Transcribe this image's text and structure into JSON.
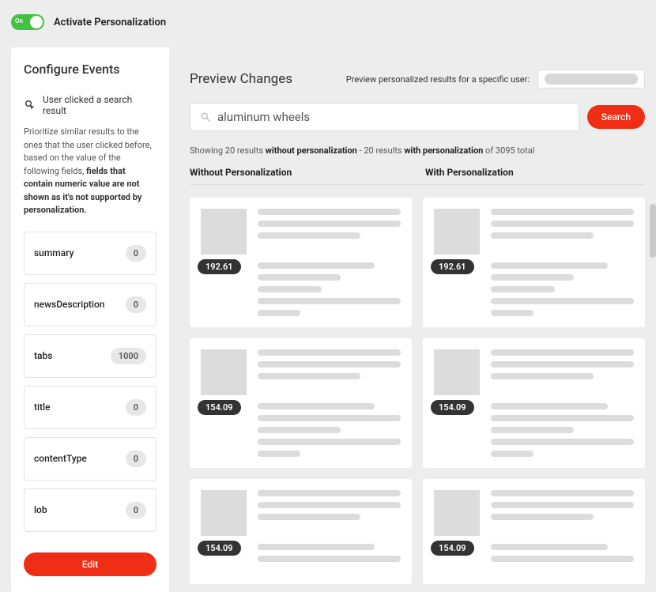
{
  "toggle": {
    "on_label": "On",
    "activate_label": "Activate Personalization"
  },
  "sidebar": {
    "title": "Configure Events",
    "event_label": "User clicked a search result",
    "desc_prefix": "Prioritize similar results to the ones that the user clicked before, based on the value of the following fields, ",
    "desc_bold": "fields that contain numeric value are not shown as it's not supported by personalization.",
    "fields": [
      {
        "name": "summary",
        "value": "0"
      },
      {
        "name": "newsDescription",
        "value": "0"
      },
      {
        "name": "tabs",
        "value": "1000"
      },
      {
        "name": "title",
        "value": "0"
      },
      {
        "name": "contentType",
        "value": "0"
      },
      {
        "name": "lob",
        "value": "0"
      }
    ],
    "edit_label": "Edit"
  },
  "preview": {
    "title": "Preview Changes",
    "user_prompt": "Preview personalized results for a specific user:",
    "search_value": "aluminum wheels",
    "search_button": "Search",
    "summary": {
      "prefix": "Showing 20 results ",
      "without": "without personalization",
      "mid": " - 20 results ",
      "with": "with personalization",
      "suffix": " of 3095 total"
    },
    "col_without": "Without Personalization",
    "col_with": "With Personalization",
    "results_without": [
      {
        "score": "192.61"
      },
      {
        "score": "154.09"
      },
      {
        "score": "154.09"
      }
    ],
    "results_with": [
      {
        "score": "192.61"
      },
      {
        "score": "154.09"
      },
      {
        "score": "154.09"
      }
    ]
  }
}
